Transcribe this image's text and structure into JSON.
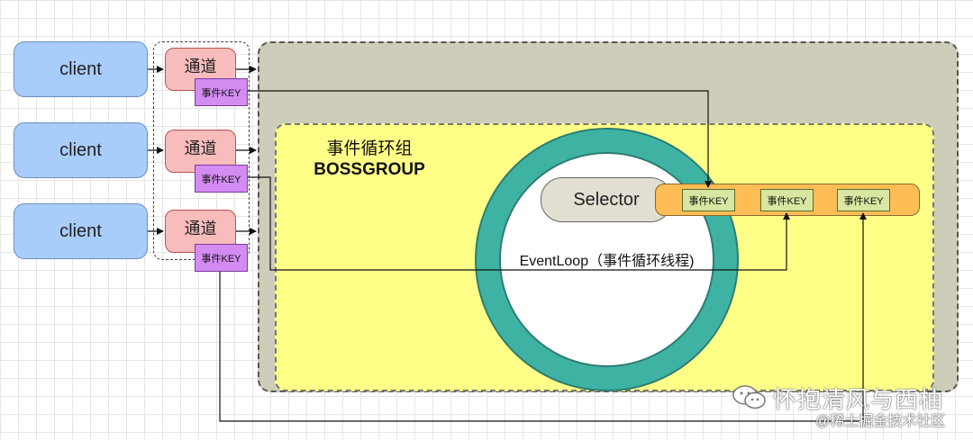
{
  "clients": [
    {
      "label": "client"
    },
    {
      "label": "client"
    },
    {
      "label": "client"
    }
  ],
  "channels": [
    {
      "label": "通道",
      "key": "事件KEY"
    },
    {
      "label": "通道",
      "key": "事件KEY"
    },
    {
      "label": "通道",
      "key": "事件KEY"
    }
  ],
  "boss_group": {
    "title": "事件循环组",
    "subtitle": "BOSSGROUP"
  },
  "event_loop": {
    "label": "EventLoop（事件循环线程)",
    "selector_label": "Selector",
    "selected_keys": [
      "事件KEY",
      "事件KEY",
      "事件KEY"
    ]
  },
  "watermark": {
    "main": "怀抱清风与西柚",
    "sub": "@稀土掘金技术社区"
  },
  "colors": {
    "client": "#a9cdfb",
    "channel": "#f8bcbc",
    "channel_key": "#d38cf2",
    "boss_outer": "#cdcdb9",
    "boss_inner": "#ffff88",
    "event_loop_ring": "#3fb3a3",
    "selector": "#e3ded2",
    "selected_bar": "#ffbd55",
    "selected_key": "#d7e6a0"
  }
}
